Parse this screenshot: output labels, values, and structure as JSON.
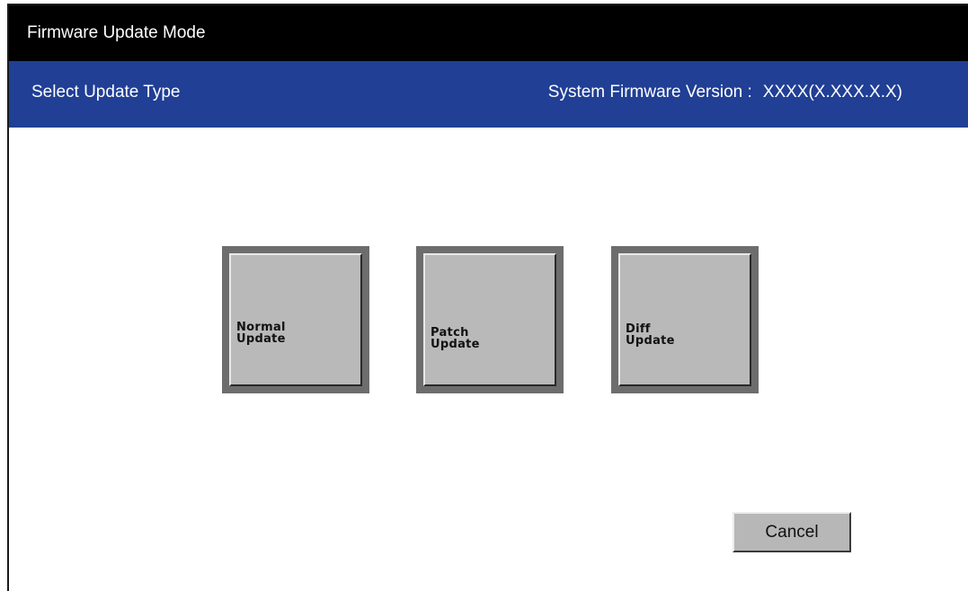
{
  "window": {
    "title": "Firmware Update Mode"
  },
  "header": {
    "subtitle": "Select Update Type",
    "version_label": "System Firmware Version :",
    "version_value": "XXXX(X.XXX.X.X)"
  },
  "update_buttons": [
    {
      "line1": "Normal",
      "line2": "Update"
    },
    {
      "line1": "Patch",
      "line2": "Update"
    },
    {
      "line1": "Diff",
      "line2": "Update"
    }
  ],
  "footer": {
    "cancel_label": "Cancel"
  },
  "colors": {
    "title_bar": "#000000",
    "header_bar": "#203f95",
    "button_face": "#b9b9b9",
    "button_frame": "#6d6d6d"
  }
}
